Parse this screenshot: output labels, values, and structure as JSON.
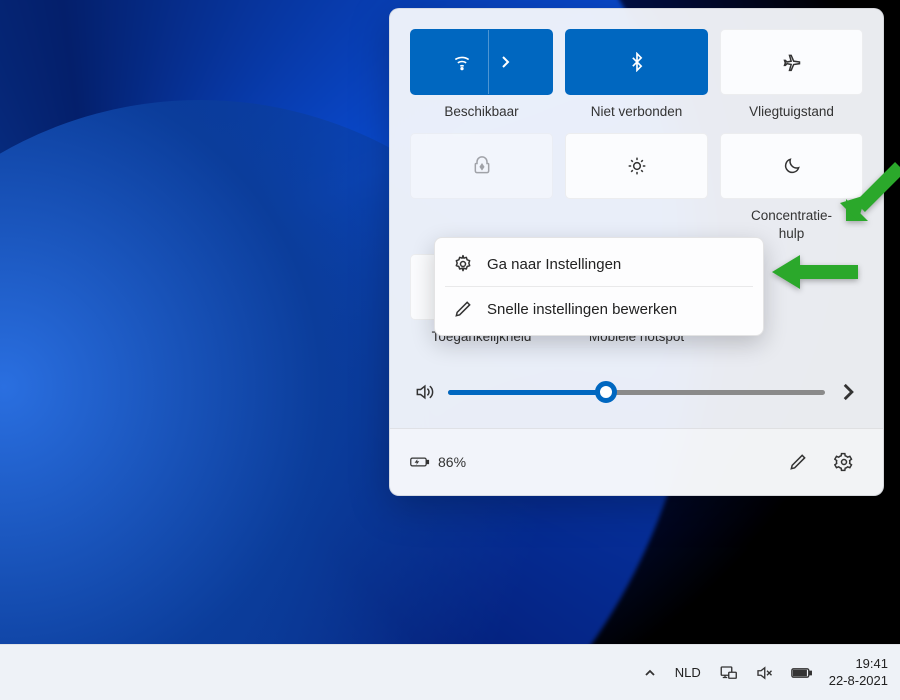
{
  "tiles": {
    "wifi": {
      "label": "Beschikbaar",
      "active": true
    },
    "bluetooth": {
      "label": "Niet verbonden",
      "active": true
    },
    "airplane": {
      "label": "Vliegtuigstand",
      "active": false
    },
    "batterysaver": {
      "label": "",
      "active": false
    },
    "nightlight": {
      "label": "",
      "active": false
    },
    "focus": {
      "label_line1": "Concentratie-",
      "label_line2": "hulp",
      "active": false
    },
    "accessibility": {
      "label": "Toegankelijkheid",
      "active": false
    },
    "hotspot": {
      "label": "Mobiele hotspot",
      "active": false
    }
  },
  "context_menu": {
    "settings": "Ga naar Instellingen",
    "edit": "Snelle instellingen bewerken"
  },
  "slider": {
    "volume_percent": 42
  },
  "footer": {
    "battery_text": "86%"
  },
  "taskbar": {
    "lang": "NLD",
    "time": "19:41",
    "date": "22-8-2021"
  },
  "colors": {
    "accent": "#0067c0",
    "arrow": "#2ba82b"
  }
}
